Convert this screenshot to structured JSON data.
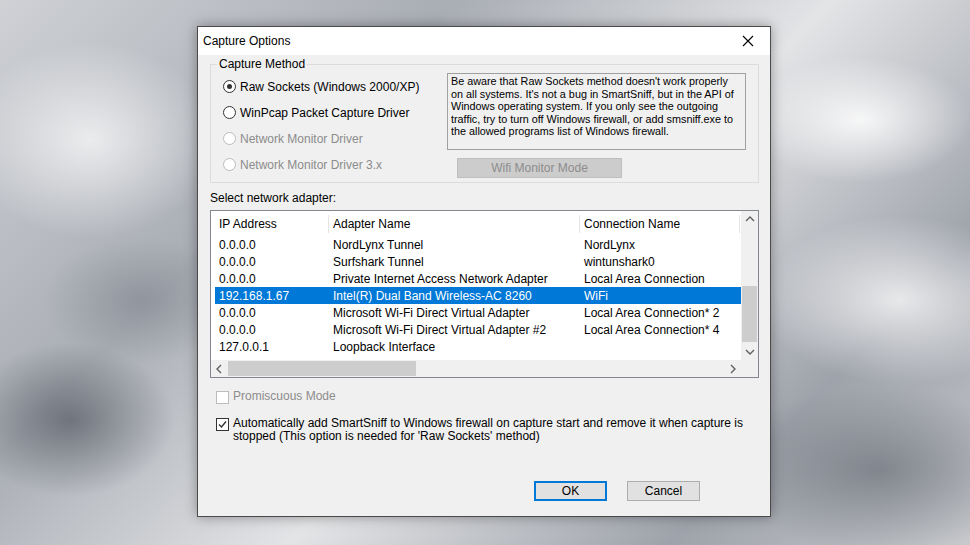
{
  "window": {
    "title": "Capture Options"
  },
  "capture_method": {
    "label": "Capture Method",
    "options": [
      {
        "label": "Raw Sockets (Windows 2000/XP)",
        "selected": true,
        "disabled": false
      },
      {
        "label": "WinPcap Packet Capture Driver",
        "selected": false,
        "disabled": false
      },
      {
        "label": "Network Monitor Driver",
        "selected": false,
        "disabled": true
      },
      {
        "label": "Network Monitor Driver 3.x",
        "selected": false,
        "disabled": true
      }
    ],
    "note": "Be aware that Raw Sockets method doesn't work properly on all systems. It's not a bug in SmartSniff, but in the API of Windows operating system. If you only see the outgoing traffic, try to turn off Windows firewall, or add smsniff.exe to the allowed programs list of Windows firewall.",
    "wifi_button": {
      "label": "Wifi Monitor Mode",
      "disabled": true
    }
  },
  "adapters": {
    "label": "Select network adapter:",
    "columns": [
      "IP Address",
      "Adapter Name",
      "Connection Name"
    ],
    "rows": [
      {
        "ip": "0.0.0.0",
        "adapter": "NordLynx Tunnel",
        "connection": "NordLynx",
        "selected": false
      },
      {
        "ip": "0.0.0.0",
        "adapter": "Surfshark Tunnel",
        "connection": "wintunshark0",
        "selected": false
      },
      {
        "ip": "0.0.0.0",
        "adapter": "Private Internet Access Network Adapter",
        "connection": "Local Area Connection",
        "selected": false
      },
      {
        "ip": "192.168.1.67",
        "adapter": "Intel(R) Dual Band Wireless-AC 8260",
        "connection": "WiFi",
        "selected": true
      },
      {
        "ip": "0.0.0.0",
        "adapter": "Microsoft Wi-Fi Direct Virtual Adapter",
        "connection": "Local Area Connection* 2",
        "selected": false
      },
      {
        "ip": "0.0.0.0",
        "adapter": "Microsoft Wi-Fi Direct Virtual Adapter #2",
        "connection": "Local Area Connection* 4",
        "selected": false
      },
      {
        "ip": "127.0.0.1",
        "adapter": "Loopback Interface",
        "connection": "",
        "selected": false
      }
    ],
    "scrollbars": {
      "vertical": {
        "start": 0.5,
        "size": 0.49
      },
      "horizontal": {
        "start": 0,
        "size": 0.38
      }
    }
  },
  "options": [
    {
      "label": "Promiscuous Mode",
      "checked": false,
      "disabled": true
    },
    {
      "label": "Automatically add SmartSniff to Windows firewall on capture start and remove it when capture is stopped (This option is needed for 'Raw Sockets' method)",
      "checked": true,
      "disabled": false
    }
  ],
  "buttons": [
    {
      "label": "OK",
      "default": true
    },
    {
      "label": "Cancel",
      "default": false
    }
  ]
}
